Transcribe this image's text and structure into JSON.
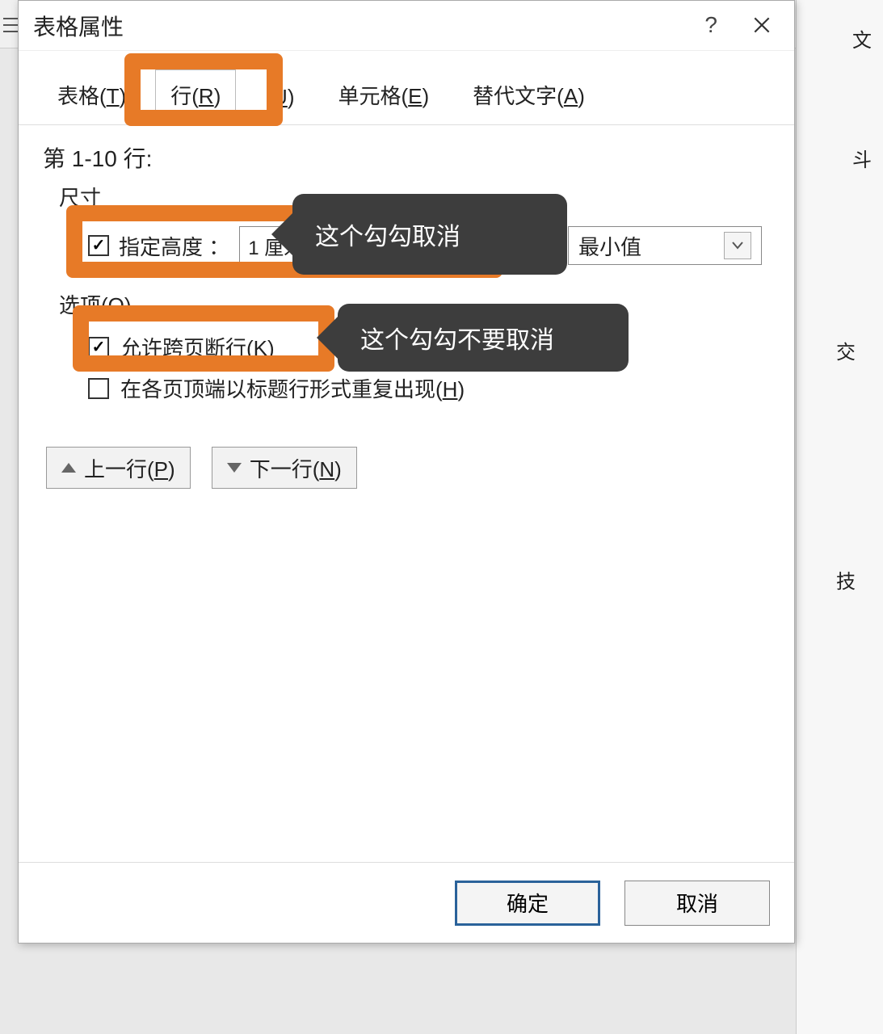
{
  "dialog": {
    "title": "表格属性",
    "help": "?",
    "tabs": {
      "table": "表格(T)",
      "row": "行(R)",
      "column_suffix": "(U)",
      "cell": "单元格(E)",
      "alt": "替代文字(A)"
    },
    "rows_label": "第 1-10 行:",
    "size_label": "尺寸",
    "specify_height": "指定高度",
    "height_value": "1 厘米",
    "height_is_suffix": "):",
    "height_is_value": "最小值",
    "options_label": "选项(O)",
    "allow_break": "允许跨页断行(K)",
    "repeat_header": "在各页顶端以标题行形式重复出现(H)",
    "prev_row": "上一行(P)",
    "next_row": "下一行(N)",
    "ok": "确定",
    "cancel": "取消"
  },
  "annotations": {
    "tip1": "这个勾勾取消",
    "tip2": "这个勾勾不要取消"
  },
  "right_fragments": {
    "f1": "文",
    "f2": "斗",
    "f3": "交",
    "f4": "技"
  }
}
